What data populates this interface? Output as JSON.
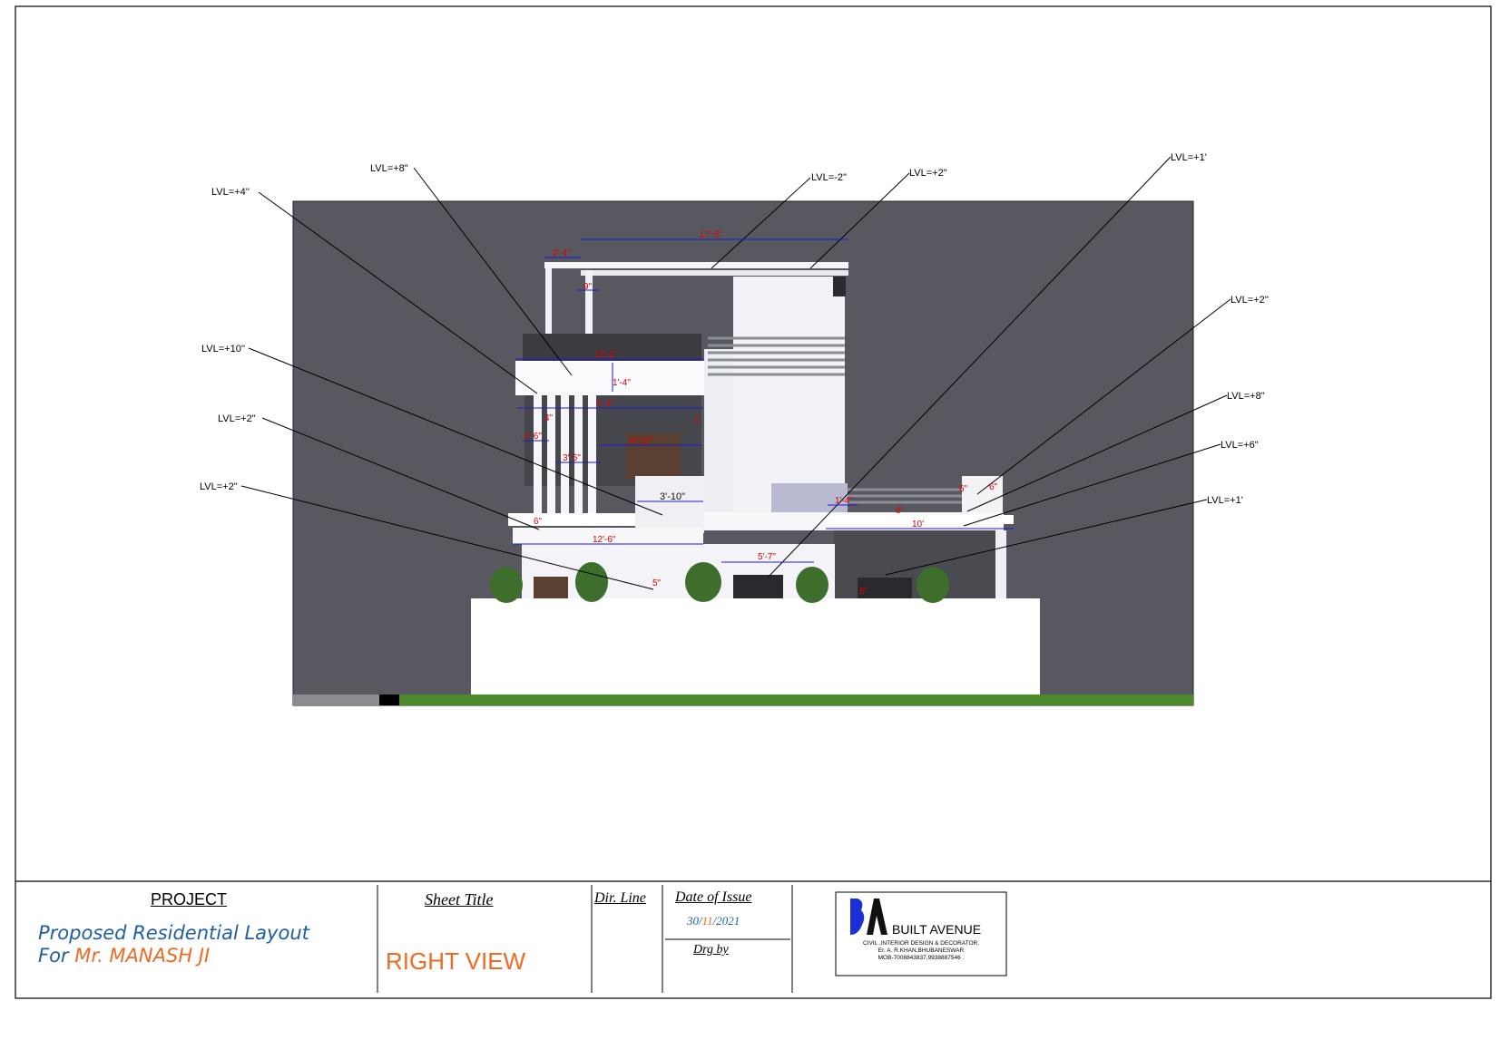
{
  "colors": {
    "background": "#585860",
    "dimension_red": "#e00000",
    "dimension_blue": "#1a1ad0",
    "project_blue": "#1f5fa0",
    "accent_orange": "#ef6a22",
    "brand_blue": "#1a2fd6"
  },
  "levels": {
    "l1": "LVL=+8\"",
    "l2": "LVL=+4''",
    "l3": "LVL=-2''",
    "l4": "LVL=+2\"",
    "l5": "LVL=+1'",
    "l6": "LVL=+2''",
    "l7": "LVL=+10''",
    "l8": "LVL=+8\"",
    "l9": "LVL=+2\"",
    "l10": "LVL=+6\"",
    "l11": "LVL=+2\"",
    "l12": "LVL=+1'"
  },
  "dims": {
    "d1": "17'-5\"",
    "d2": "2'-4\"",
    "d3": "9\"",
    "d4": "12'-2\"",
    "d5": "1'-4\"",
    "d6": "1'-4\"",
    "d7": "1'",
    "d8": "4'-10\"",
    "d9": "1'-6\"",
    "d10": "3'-5\"",
    "d11": "3'-10\"",
    "d12": "12'-6\"",
    "d13": "5'-7\"",
    "d14": "1'-4\"",
    "d15": "10'",
    "d16": "6\"",
    "d17": "6\"",
    "d18": "5\"",
    "d19": "5\"",
    "d20": "4\"",
    "d21": "6\"",
    "d22": "8\""
  },
  "title_block": {
    "project_label": "PROJECT",
    "project_line1": "Proposed Residential Layout",
    "project_for": "For",
    "client_name": "Mr. MANASH  JI",
    "sheet_title_label": "Sheet Title",
    "sheet_title": "RIGHT VIEW",
    "dir_line_label": "Dir. Line",
    "date_label": "Date of Issue",
    "date_day": "30/",
    "date_month": "11",
    "date_year": "/2021",
    "drg_by_label": "Drg by",
    "brand_name": "BUILT AVENUE",
    "brand_line1": "CIVIL ,INTERIOR DESIGN & DECORATOR.",
    "brand_line2": "Er. A. R.KHAN,BHUBANESWAR",
    "brand_line3": "MOB-7008843837,9938887546 ."
  }
}
